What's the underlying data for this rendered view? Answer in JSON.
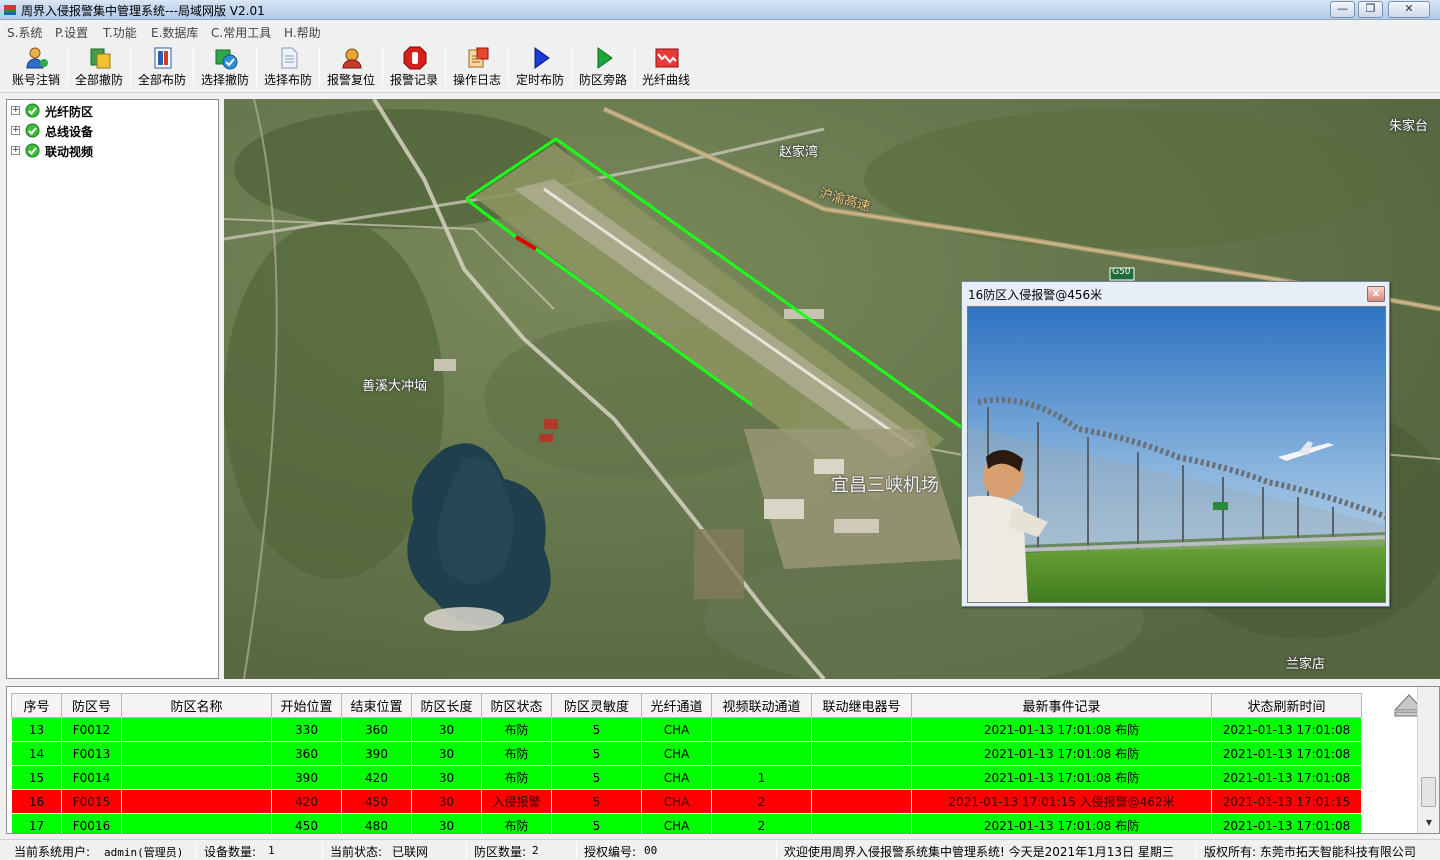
{
  "window": {
    "title": "周界入侵报警集中管理系统---局域网版 V2.01",
    "minimize": "0",
    "maximize": "1",
    "close": "r"
  },
  "menu": [
    "S.系统",
    "P.设置",
    "T.功能",
    "E.数据库",
    "C.常用工具",
    "H.帮助"
  ],
  "toolbar": [
    {
      "label": "账号注销",
      "icon": "user-logout-icon"
    },
    {
      "label": "全部撤防",
      "icon": "disarm-all-icon"
    },
    {
      "label": "全部布防",
      "icon": "arm-all-icon"
    },
    {
      "label": "选择撤防",
      "icon": "select-disarm-icon"
    },
    {
      "label": "选择布防",
      "icon": "select-arm-icon"
    },
    {
      "label": "报警复位",
      "icon": "alarm-reset-icon"
    },
    {
      "label": "报警记录",
      "icon": "alarm-log-icon"
    },
    {
      "label": "操作日志",
      "icon": "operation-log-icon"
    },
    {
      "label": "定时布防",
      "icon": "timed-arm-icon"
    },
    {
      "label": "防区旁路",
      "icon": "zone-bypass-icon"
    },
    {
      "label": "光纤曲线",
      "icon": "fiber-curve-icon"
    }
  ],
  "tree": [
    {
      "label": "光纤防区",
      "expander": "+"
    },
    {
      "label": "总线设备",
      "expander": "+"
    },
    {
      "label": "联动视频",
      "expander": "+"
    }
  ],
  "map": {
    "labels": {
      "village_1": "赵家湾",
      "road": "沪渝高速",
      "village_2": "朱家台",
      "highway_badge": "G50",
      "village_3": "善溪大冲垴",
      "airport": "宜昌三峡机场",
      "village_4": "兰家店"
    }
  },
  "popup": {
    "title": "16防区入侵报警@456米",
    "close": "x"
  },
  "grid": {
    "columns": [
      "序号",
      "防区号",
      "防区名称",
      "开始位置",
      "结束位置",
      "防区长度",
      "防区状态",
      "防区灵敏度",
      "光纤通道",
      "视频联动通道",
      "联动继电器号",
      "最新事件记录",
      "状态刷新时间"
    ],
    "rows": [
      {
        "status_class": "ok",
        "cells": [
          "13",
          "F0012",
          "",
          "330",
          "360",
          "30",
          "布防",
          "5",
          "CHA",
          "",
          "",
          "2021-01-13 17:01:08 布防",
          "2021-01-13 17:01:08"
        ]
      },
      {
        "status_class": "ok",
        "cells": [
          "14",
          "F0013",
          "",
          "360",
          "390",
          "30",
          "布防",
          "5",
          "CHA",
          "",
          "",
          "2021-01-13 17:01:08 布防",
          "2021-01-13 17:01:08"
        ]
      },
      {
        "status_class": "ok",
        "cells": [
          "15",
          "F0014",
          "",
          "390",
          "420",
          "30",
          "布防",
          "5",
          "CHA",
          "1",
          "",
          "2021-01-13 17:01:08 布防",
          "2021-01-13 17:01:08"
        ]
      },
      {
        "status_class": "alarm",
        "cells": [
          "16",
          "F0015",
          "",
          "420",
          "450",
          "30",
          "入侵报警",
          "5",
          "CHA",
          "2",
          "",
          "2021-01-13 17:01:15  入侵报警@462米",
          "2021-01-13 17:01:15"
        ]
      },
      {
        "status_class": "ok",
        "cells": [
          "17",
          "F0016",
          "",
          "450",
          "480",
          "30",
          "布防",
          "5",
          "CHA",
          "2",
          "",
          "2021-01-13 17:01:08 布防",
          "2021-01-13 17:01:08"
        ]
      }
    ]
  },
  "status": {
    "user_label": "当前系统用户:",
    "user_value": "admin(管理员)",
    "device_label": "设备数量:",
    "device_value": "1",
    "state_label": "当前状态:",
    "state_value": "已联网",
    "zone_label": "防区数量:",
    "zone_value": "2",
    "license_label": "授权编号:",
    "license_value": "00",
    "welcome": "欢迎使用周界入侵报警系统集中管理系统!   今天是2021年1月13日   星期三",
    "copyright": "版权所有: 东莞市拓天智能科技有限公司"
  },
  "colors": {
    "armed": "#00ff00",
    "alarm": "#ff0000",
    "fence_line": "#1aff1a",
    "fence_alarm": "#e00000"
  }
}
